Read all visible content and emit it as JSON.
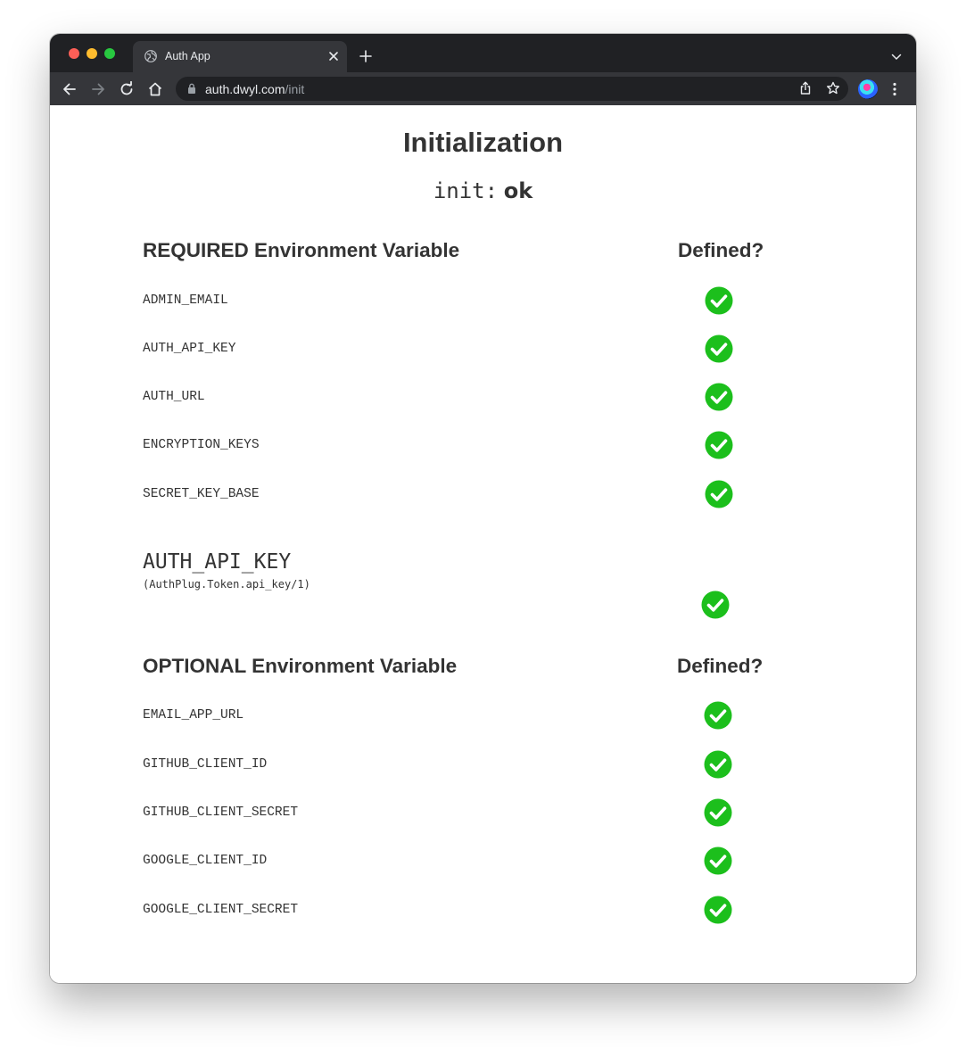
{
  "browser": {
    "tab_title": "Auth App",
    "url_host": "auth.dwyl.com",
    "url_path": "/init"
  },
  "page": {
    "title": "Initialization",
    "status_key": "init:",
    "status_value": "ok",
    "required": {
      "heading": "REQUIRED Environment Variable",
      "defined_heading": "Defined?",
      "items": [
        {
          "name": "ADMIN_EMAIL",
          "defined": true
        },
        {
          "name": "AUTH_API_KEY",
          "defined": true
        },
        {
          "name": "AUTH_URL",
          "defined": true
        },
        {
          "name": "ENCRYPTION_KEYS",
          "defined": true
        },
        {
          "name": "SECRET_KEY_BASE",
          "defined": true
        }
      ]
    },
    "api_key": {
      "name": "AUTH_API_KEY",
      "function": "(AuthPlug.Token.api_key/1)",
      "defined": true
    },
    "optional": {
      "heading": "OPTIONAL Environment Variable",
      "defined_heading": "Defined?",
      "items": [
        {
          "name": "EMAIL_APP_URL",
          "defined": true
        },
        {
          "name": "GITHUB_CLIENT_ID",
          "defined": true
        },
        {
          "name": "GITHUB_CLIENT_SECRET",
          "defined": true
        },
        {
          "name": "GOOGLE_CLIENT_ID",
          "defined": true
        },
        {
          "name": "GOOGLE_CLIENT_SECRET",
          "defined": true
        }
      ]
    }
  },
  "colors": {
    "check_green": "#1cbf1c",
    "text": "#333333"
  }
}
